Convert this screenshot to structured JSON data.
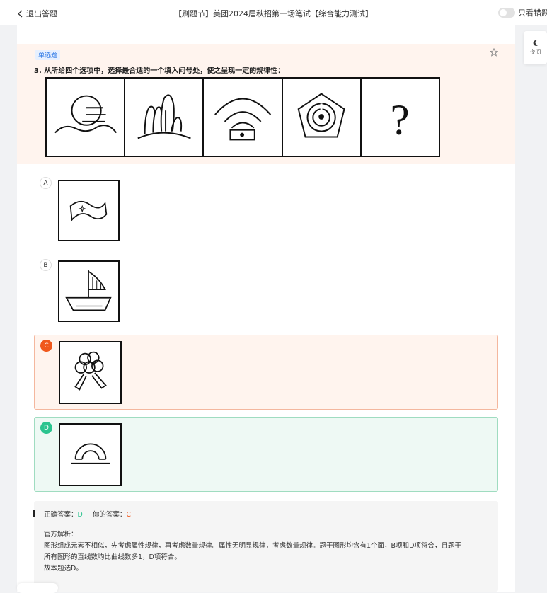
{
  "header": {
    "back_label": "退出答题",
    "title": "【刷题节】美团2024届秋招第一场笔试【综合能力测试】",
    "toggle_label": "只看错题"
  },
  "side": {
    "night_label": "夜间"
  },
  "question": {
    "type_badge": "单选题",
    "text": "3. 从所给四个选项中，选择最合适的一个填入问号处，使之呈现一定的规律性：",
    "question_mark": "?"
  },
  "options": [
    {
      "letter": "A",
      "icon": "flag-with-star",
      "state": "normal"
    },
    {
      "letter": "B",
      "icon": "sailboat",
      "state": "normal"
    },
    {
      "letter": "C",
      "icon": "flowers-crossed-sticks",
      "state": "wrong"
    },
    {
      "letter": "D",
      "icon": "half-circle-on-lines",
      "state": "correct"
    }
  ],
  "analysis": {
    "correct_label": "正确答案：",
    "correct_value": "D",
    "yours_label": "你的答案：",
    "yours_value": "C",
    "heading": "官方解析：",
    "body_line1": "图形组成元素不相似，先考虑属性规律，再考虑数量规律。属性无明显规律，考虑数量规律。题干图形均含有1个面，B项和D项符合，且题干",
    "body_line2": "所有图形的直线数均比曲线数多1，D项符合。",
    "conclusion": "故本题选D。"
  },
  "colors": {
    "wrong": "#f0581d",
    "correct": "#2bc48f",
    "badge": "#2a77e6"
  }
}
